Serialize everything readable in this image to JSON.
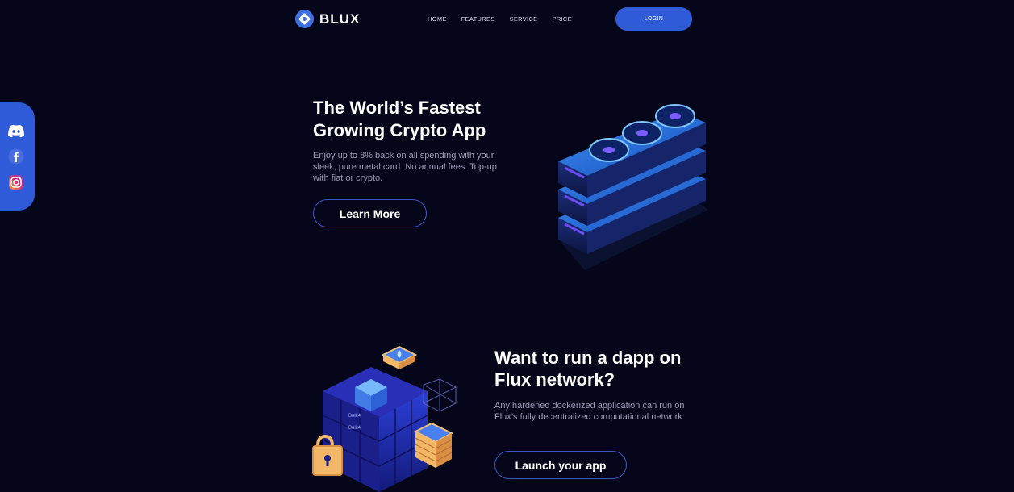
{
  "header": {
    "brand": "BLUX",
    "nav": [
      "HOME",
      "FEATURES",
      "SERVICE",
      "PRICE"
    ],
    "login_label": "LOGIN"
  },
  "social": {
    "icons": [
      "discord-icon",
      "facebook-icon",
      "instagram-icon"
    ]
  },
  "hero": {
    "title": "The World’s Fastest Growing Crypto App",
    "description": "Enjoy up to 8% back on all spending with your sleek, pure metal card. No annual fees. Top-up with fiat or crypto.",
    "button_label": "Learn More"
  },
  "section2": {
    "title": "Want to run a dapp on Flux network?",
    "description": "Any hardened dockerized application can run on Flux’s fully decentralized computational network",
    "button_label": "Launch your app",
    "art_labels": [
      "Bulk4",
      "Bulk4"
    ]
  },
  "colors": {
    "background": "#05061a",
    "accent": "#2f5bd8",
    "button_border": "#3e56c9",
    "muted_text": "#9c9fb6"
  }
}
